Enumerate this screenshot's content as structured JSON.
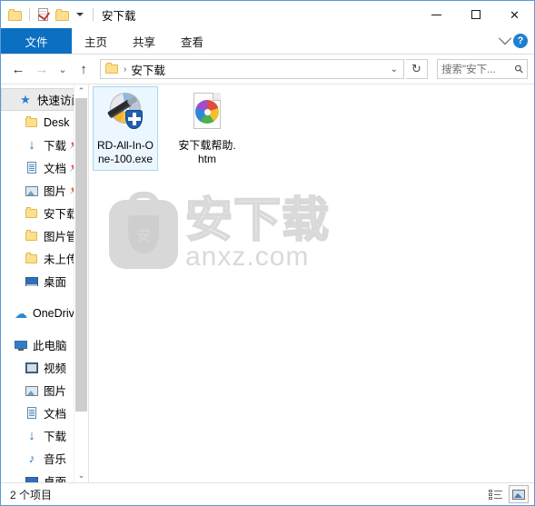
{
  "window": {
    "title": "安下载",
    "quick_access_toolbar": [
      {
        "name": "folder-icon",
        "label": ""
      },
      {
        "name": "properties-icon",
        "label": ""
      },
      {
        "name": "new-folder-icon",
        "label": ""
      },
      {
        "name": "customize-dropdown",
        "label": ""
      }
    ],
    "controls": {
      "minimize": "—",
      "maximize": "□",
      "close": "✕"
    }
  },
  "ribbon": {
    "tabs": [
      {
        "label": "文件",
        "active": true
      },
      {
        "label": "主页",
        "active": false
      },
      {
        "label": "共享",
        "active": false
      },
      {
        "label": "查看",
        "active": false
      }
    ],
    "collapse_icon": "chevron-down",
    "help_label": "?"
  },
  "address_bar": {
    "back": "←",
    "forward": "→",
    "recent": "⌄",
    "up": "↑",
    "breadcrumb": "安下载",
    "breadcrumb_separator": "›",
    "dropdown": "⌄",
    "refresh": "↻"
  },
  "search": {
    "placeholder": "搜索\"安下...",
    "icon": "🔍"
  },
  "sidebar": {
    "items": [
      {
        "label": "快速访问",
        "icon": "star-icon",
        "selected": true,
        "pinned": false,
        "indent": 1
      },
      {
        "label": "Desk",
        "icon": "folder-icon",
        "selected": false,
        "pinned": true,
        "indent": 2
      },
      {
        "label": "下载",
        "icon": "download-icon",
        "selected": false,
        "pinned": true,
        "indent": 2
      },
      {
        "label": "文档",
        "icon": "document-icon",
        "selected": false,
        "pinned": true,
        "indent": 2
      },
      {
        "label": "图片",
        "icon": "picture-icon",
        "selected": false,
        "pinned": true,
        "indent": 2
      },
      {
        "label": "安下载",
        "icon": "folder-icon",
        "selected": false,
        "pinned": false,
        "indent": 2
      },
      {
        "label": "图片管理",
        "icon": "folder-icon",
        "selected": false,
        "pinned": false,
        "indent": 2
      },
      {
        "label": "未上传",
        "icon": "folder-icon",
        "selected": false,
        "pinned": false,
        "indent": 2
      },
      {
        "label": "桌面",
        "icon": "desktop-icon",
        "selected": false,
        "pinned": false,
        "indent": 2
      },
      {
        "label": "OneDrive",
        "icon": "cloud-icon",
        "selected": false,
        "pinned": false,
        "indent": 0
      },
      {
        "label": "此电脑",
        "icon": "computer-icon",
        "selected": false,
        "pinned": false,
        "indent": 0
      },
      {
        "label": "视频",
        "icon": "video-icon",
        "selected": false,
        "pinned": false,
        "indent": 2
      },
      {
        "label": "图片",
        "icon": "picture-icon",
        "selected": false,
        "pinned": false,
        "indent": 2
      },
      {
        "label": "文档",
        "icon": "document-icon",
        "selected": false,
        "pinned": false,
        "indent": 2
      },
      {
        "label": "下载",
        "icon": "download-icon",
        "selected": false,
        "pinned": false,
        "indent": 2
      },
      {
        "label": "音乐",
        "icon": "music-icon",
        "selected": false,
        "pinned": false,
        "indent": 2
      },
      {
        "label": "桌面",
        "icon": "desktop-icon",
        "selected": false,
        "pinned": false,
        "indent": 2
      }
    ],
    "scroll_up": "⌃",
    "scroll_down": "⌄"
  },
  "files": [
    {
      "name": "RD-All-In-One-100.exe",
      "icon": "exe-installer-icon",
      "selected": true
    },
    {
      "name": "安下载帮助.htm",
      "icon": "html-document-icon",
      "selected": false
    }
  ],
  "watermark": {
    "badge_text": "安",
    "title": "安下载",
    "url": "anxz.com"
  },
  "status_bar": {
    "item_count": "2 个项目",
    "views": [
      {
        "name": "details-view",
        "active": false
      },
      {
        "name": "large-icons-view",
        "active": true
      }
    ]
  }
}
